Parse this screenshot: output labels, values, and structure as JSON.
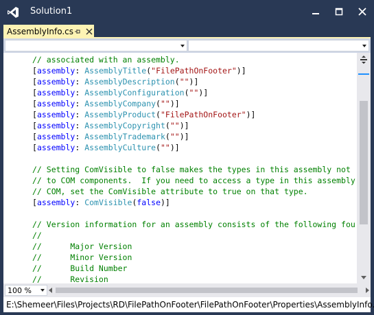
{
  "window": {
    "title": "Solution1",
    "accent_color": "#293955",
    "tab_color": "#fdf3b4"
  },
  "tab": {
    "label": "AssemblyInfo.cs",
    "pin_icon": "pin-icon",
    "close_icon": "close-icon"
  },
  "navbar": {
    "left_combo_value": "",
    "right_combo_value": ""
  },
  "code_lines": [
    [
      {
        "c": "c",
        "t": "// associated with an assembly."
      }
    ],
    [
      {
        "c": "",
        "t": "["
      },
      {
        "c": "k",
        "t": "assembly"
      },
      {
        "c": "",
        "t": ": "
      },
      {
        "c": "t",
        "t": "AssemblyTitle"
      },
      {
        "c": "",
        "t": "("
      },
      {
        "c": "s",
        "t": "\"FilePathOnFooter\""
      },
      {
        "c": "",
        "t": ")]"
      }
    ],
    [
      {
        "c": "",
        "t": "["
      },
      {
        "c": "k",
        "t": "assembly"
      },
      {
        "c": "",
        "t": ": "
      },
      {
        "c": "t",
        "t": "AssemblyDescription"
      },
      {
        "c": "",
        "t": "("
      },
      {
        "c": "s",
        "t": "\"\""
      },
      {
        "c": "",
        "t": ")]"
      }
    ],
    [
      {
        "c": "",
        "t": "["
      },
      {
        "c": "k",
        "t": "assembly"
      },
      {
        "c": "",
        "t": ": "
      },
      {
        "c": "t",
        "t": "AssemblyConfiguration"
      },
      {
        "c": "",
        "t": "("
      },
      {
        "c": "s",
        "t": "\"\""
      },
      {
        "c": "",
        "t": ")]"
      }
    ],
    [
      {
        "c": "",
        "t": "["
      },
      {
        "c": "k",
        "t": "assembly"
      },
      {
        "c": "",
        "t": ": "
      },
      {
        "c": "t",
        "t": "AssemblyCompany"
      },
      {
        "c": "",
        "t": "("
      },
      {
        "c": "s",
        "t": "\"\""
      },
      {
        "c": "",
        "t": ")]"
      }
    ],
    [
      {
        "c": "",
        "t": "["
      },
      {
        "c": "k",
        "t": "assembly"
      },
      {
        "c": "",
        "t": ": "
      },
      {
        "c": "t",
        "t": "AssemblyProduct"
      },
      {
        "c": "",
        "t": "("
      },
      {
        "c": "s",
        "t": "\"FilePathOnFooter\""
      },
      {
        "c": "",
        "t": ")]"
      }
    ],
    [
      {
        "c": "",
        "t": "["
      },
      {
        "c": "k",
        "t": "assembly"
      },
      {
        "c": "",
        "t": ": "
      },
      {
        "c": "t",
        "t": "AssemblyCopyright"
      },
      {
        "c": "",
        "t": "("
      },
      {
        "c": "s",
        "t": "\"\""
      },
      {
        "c": "",
        "t": ")]"
      }
    ],
    [
      {
        "c": "",
        "t": "["
      },
      {
        "c": "k",
        "t": "assembly"
      },
      {
        "c": "",
        "t": ": "
      },
      {
        "c": "t",
        "t": "AssemblyTrademark"
      },
      {
        "c": "",
        "t": "("
      },
      {
        "c": "s",
        "t": "\"\""
      },
      {
        "c": "",
        "t": ")]"
      }
    ],
    [
      {
        "c": "",
        "t": "["
      },
      {
        "c": "k",
        "t": "assembly"
      },
      {
        "c": "",
        "t": ": "
      },
      {
        "c": "t",
        "t": "AssemblyCulture"
      },
      {
        "c": "",
        "t": "("
      },
      {
        "c": "s",
        "t": "\"\""
      },
      {
        "c": "",
        "t": ")]"
      }
    ],
    [],
    [
      {
        "c": "c",
        "t": "// Setting ComVisible to false makes the types in this assembly not"
      }
    ],
    [
      {
        "c": "c",
        "t": "// to COM components.  If you need to access a type in this assembly"
      }
    ],
    [
      {
        "c": "c",
        "t": "// COM, set the ComVisible attribute to true on that type."
      }
    ],
    [
      {
        "c": "",
        "t": "["
      },
      {
        "c": "k",
        "t": "assembly"
      },
      {
        "c": "",
        "t": ": "
      },
      {
        "c": "t",
        "t": "ComVisible"
      },
      {
        "c": "",
        "t": "("
      },
      {
        "c": "k",
        "t": "false"
      },
      {
        "c": "",
        "t": ")]"
      }
    ],
    [],
    [
      {
        "c": "c",
        "t": "// Version information for an assembly consists of the following fou"
      }
    ],
    [
      {
        "c": "c",
        "t": "//"
      }
    ],
    [
      {
        "c": "c",
        "t": "//      Major Version"
      }
    ],
    [
      {
        "c": "c",
        "t": "//      Minor Version"
      }
    ],
    [
      {
        "c": "c",
        "t": "//      Build Number"
      }
    ],
    [
      {
        "c": "c",
        "t": "//      Revision"
      }
    ]
  ],
  "zoom": {
    "value": "100 %"
  },
  "status": {
    "path": "E:\\Shemeer\\Files\\Projects\\RD\\FilePathOnFooter\\FilePathOnFooter\\Properties\\AssemblyInfo.cs"
  }
}
